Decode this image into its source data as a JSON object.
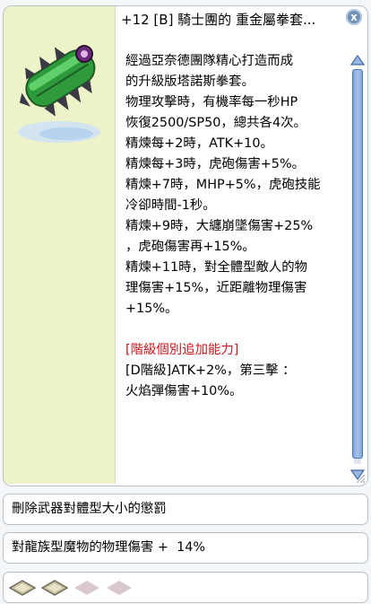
{
  "tooltip": {
    "title": "+12 [B] 騎士團的 重金屬拳套...",
    "close_glyph": "x",
    "item_icon": "green-knuckle-weapon-icon",
    "description": [
      "經過亞奈德團隊精心打造而成",
      "的升級版塔諾斯拳套。",
      "物理攻擊時，有機率每一秒HP",
      "恢復2500/SP50，總共各4次。",
      "精煉每+2時，ATK+10。",
      "精煉每+3時，虎砲傷害+5%。",
      "精煉+7時，MHP+5%，虎砲技能",
      "冷卻時間-1秒。",
      "精煉+9時，大纏崩墜傷害+25%",
      "，虎砲傷害再+15%。",
      "精煉+11時，對全體型敵人的物",
      "理傷害+15%，近距離物理傷害",
      "+15%。"
    ],
    "grade_heading": "[階級個別追加能力]",
    "grade_lines": [
      "[D階級]ATK+2%，第三擊 ：",
      "火焰彈傷害+10%。"
    ]
  },
  "options": {
    "line1": "刪除武器對體型大小的懲罰",
    "line2": "對龍族型魔物的物理傷害 +  14%"
  },
  "card_slots": {
    "filled_color": "#c9c1a2",
    "empty_color": "#d9c8d0",
    "items": [
      "filled",
      "filled",
      "empty",
      "empty"
    ]
  },
  "colors": {
    "grade_heading": "#c8181e",
    "image_panel": "#eef2c8",
    "scrollbar": "#7fa6d8"
  }
}
